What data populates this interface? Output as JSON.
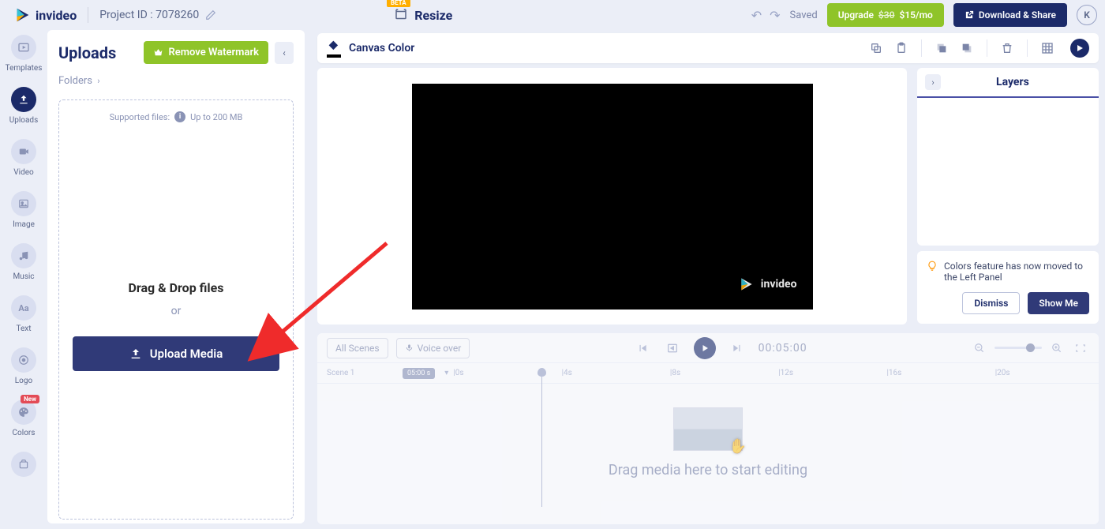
{
  "brand": "invideo",
  "header": {
    "project_id": "Project ID : 7078260",
    "resize_label": "Resize",
    "beta": "BETA",
    "saved": "Saved",
    "upgrade_prefix": "Upgrade",
    "upgrade_strike": "$30",
    "upgrade_price": "$15/mo",
    "download_share": "Download & Share",
    "avatar_initial": "K"
  },
  "rail": {
    "items": [
      {
        "label": "Templates",
        "icon": "▦"
      },
      {
        "label": "Uploads",
        "icon": "⬆",
        "active": true
      },
      {
        "label": "Video",
        "icon": "■"
      },
      {
        "label": "Image",
        "icon": "🖼"
      },
      {
        "label": "Music",
        "icon": "♪"
      },
      {
        "label": "Text",
        "icon": "Aa"
      },
      {
        "label": "Logo",
        "icon": "⊙"
      },
      {
        "label": "Colors",
        "icon": "🎨",
        "badge": "New"
      }
    ]
  },
  "uploads": {
    "title": "Uploads",
    "remove_watermark": "Remove Watermark",
    "folders": "Folders",
    "supported_prefix": "Supported files:",
    "supported_size": "Up to 200 MB",
    "drag_drop": "Drag & Drop files",
    "or": "or",
    "upload_btn": "Upload Media"
  },
  "canvas": {
    "color_label": "Canvas Color",
    "brand_watermark": "invideo"
  },
  "layers": {
    "title": "Layers"
  },
  "tip": {
    "text": "Colors feature has now moved to the Left Panel",
    "dismiss": "Dismiss",
    "showme": "Show Me"
  },
  "timeline": {
    "all_scenes": "All Scenes",
    "voice_over": "Voice over",
    "time": "00:05:00",
    "scene_label": "Scene 1",
    "duration_pill": "05:00 s",
    "ticks": [
      "|0s",
      "|4s",
      "|8s",
      "|12s",
      "|16s",
      "|20s"
    ],
    "drop_text": "Drag media here to start editing"
  }
}
